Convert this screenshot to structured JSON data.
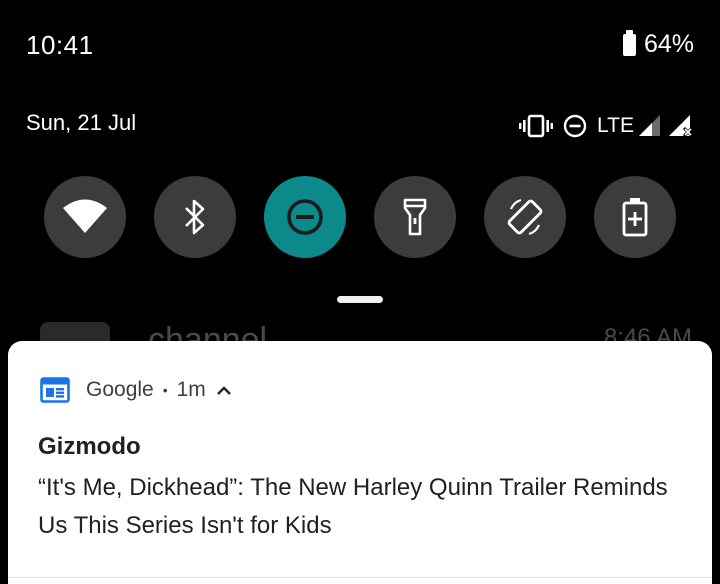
{
  "status_bar": {
    "time": "10:41",
    "battery_percent": "64%"
  },
  "quick_settings": {
    "date": "Sun, 21 Jul",
    "network_label": "LTE",
    "tiles": [
      {
        "name": "wifi",
        "active": false
      },
      {
        "name": "bluetooth",
        "active": false
      },
      {
        "name": "do-not-disturb",
        "active": true
      },
      {
        "name": "flashlight",
        "active": false
      },
      {
        "name": "auto-rotate",
        "active": false
      },
      {
        "name": "battery-saver",
        "active": false
      }
    ],
    "accent_color": "#0c8a8b"
  },
  "background_notification": {
    "title_partial": "channel",
    "time_partial": "8:46 AM"
  },
  "notification": {
    "app_name": "Google",
    "separator": "•",
    "time": "1m",
    "title": "Gizmodo",
    "body": "“It's Me, Dickhead”: The New Harley Quinn Trailer Reminds Us This Series Isn't for Kids",
    "app_icon_color": "#1a73e8"
  }
}
